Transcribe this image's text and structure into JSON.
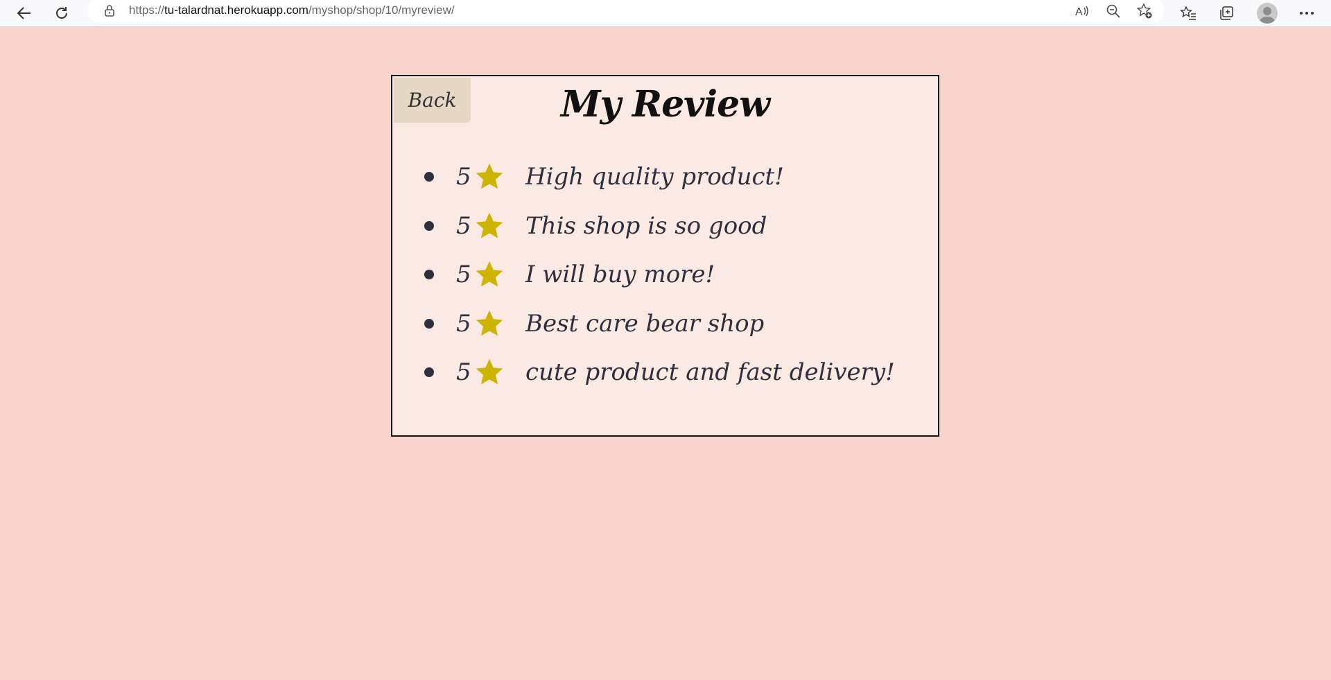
{
  "browser": {
    "url_prefix": "https://",
    "url_domain": "tu-talardnat.herokuapp.com",
    "url_path": "/myshop/shop/10/myreview/"
  },
  "page": {
    "back_label": "Back",
    "title": "My Review",
    "star_color": "#ccb400",
    "reviews": [
      {
        "rating": "5",
        "comment": "High quality product!"
      },
      {
        "rating": "5",
        "comment": "This shop is so good"
      },
      {
        "rating": "5",
        "comment": "I will buy more!"
      },
      {
        "rating": "5",
        "comment": "Best care bear shop"
      },
      {
        "rating": "5",
        "comment": "cute product and fast delivery!"
      }
    ]
  }
}
